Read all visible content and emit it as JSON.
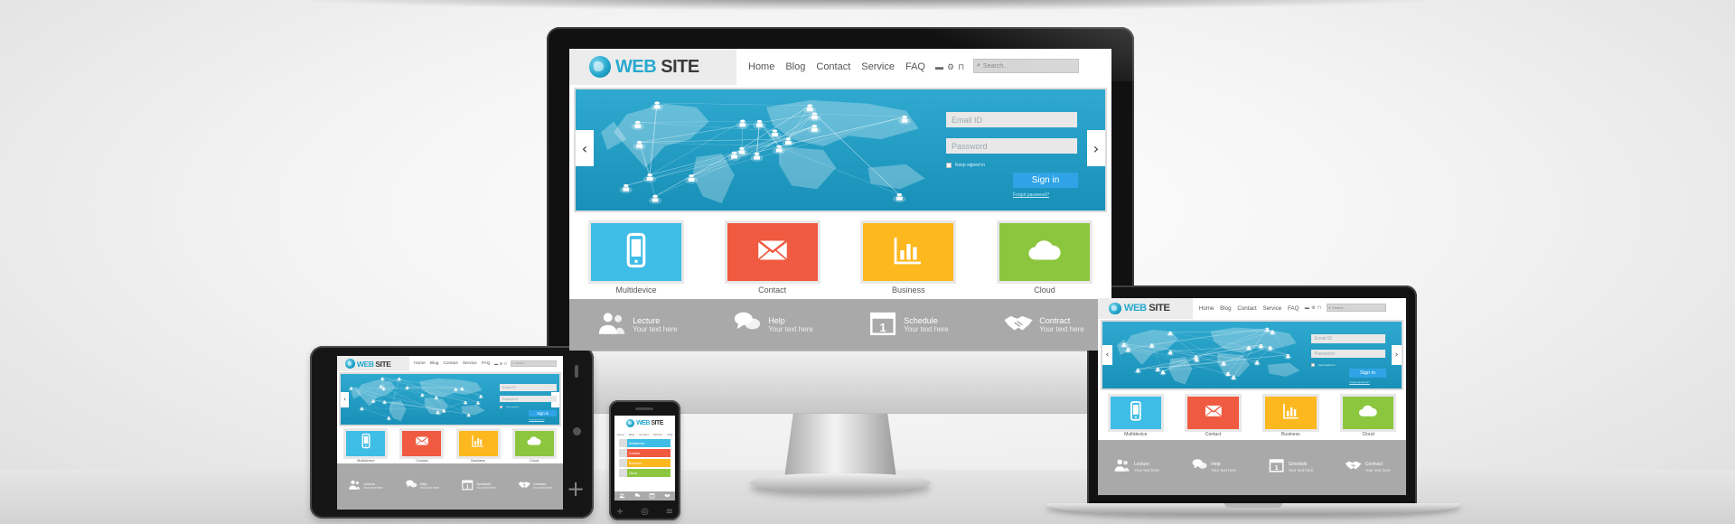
{
  "site": {
    "logo": {
      "web": "WEB",
      "rest": " SITE"
    },
    "nav": [
      "Home",
      "Blog",
      "Contact",
      "Service",
      "FAQ"
    ],
    "tool_icons": [
      "chat-icon",
      "gear-icon",
      "lock-icon"
    ],
    "search_placeholder": "Search...",
    "login": {
      "email_placeholder": "Email ID",
      "password_placeholder": "Password",
      "keep_signed_in": "Keep signed in",
      "sign_in": "Sign in",
      "forgot": "Forgot password?"
    },
    "tiles": [
      {
        "label": "Multidevice",
        "color": "#3ebde6",
        "icon": "phone-icon"
      },
      {
        "label": "Contact",
        "color": "#f05a40",
        "icon": "mail-icon"
      },
      {
        "label": "Business",
        "color": "#fcb81e",
        "icon": "chart-icon"
      },
      {
        "label": "Cloud",
        "color": "#8cc63f",
        "icon": "cloud-icon"
      }
    ],
    "bottom_bar": [
      {
        "title": "Lecture",
        "sub": "Your text here",
        "icon": "people-icon"
      },
      {
        "title": "Help",
        "sub": "Your text here",
        "icon": "speech-bubbles-icon"
      },
      {
        "title": "Schedule",
        "sub": "Your text here",
        "icon": "calendar-icon",
        "day": "1"
      },
      {
        "title": "Contract",
        "sub": "Your text here",
        "icon": "handshake-icon"
      }
    ]
  },
  "colors": {
    "accent": "#27a9cf",
    "hero": "#1fa0c8",
    "signin": "#2ea4e6",
    "bar": "#a9a9a9"
  },
  "devices": [
    "monitor",
    "laptop",
    "tablet",
    "phone"
  ]
}
